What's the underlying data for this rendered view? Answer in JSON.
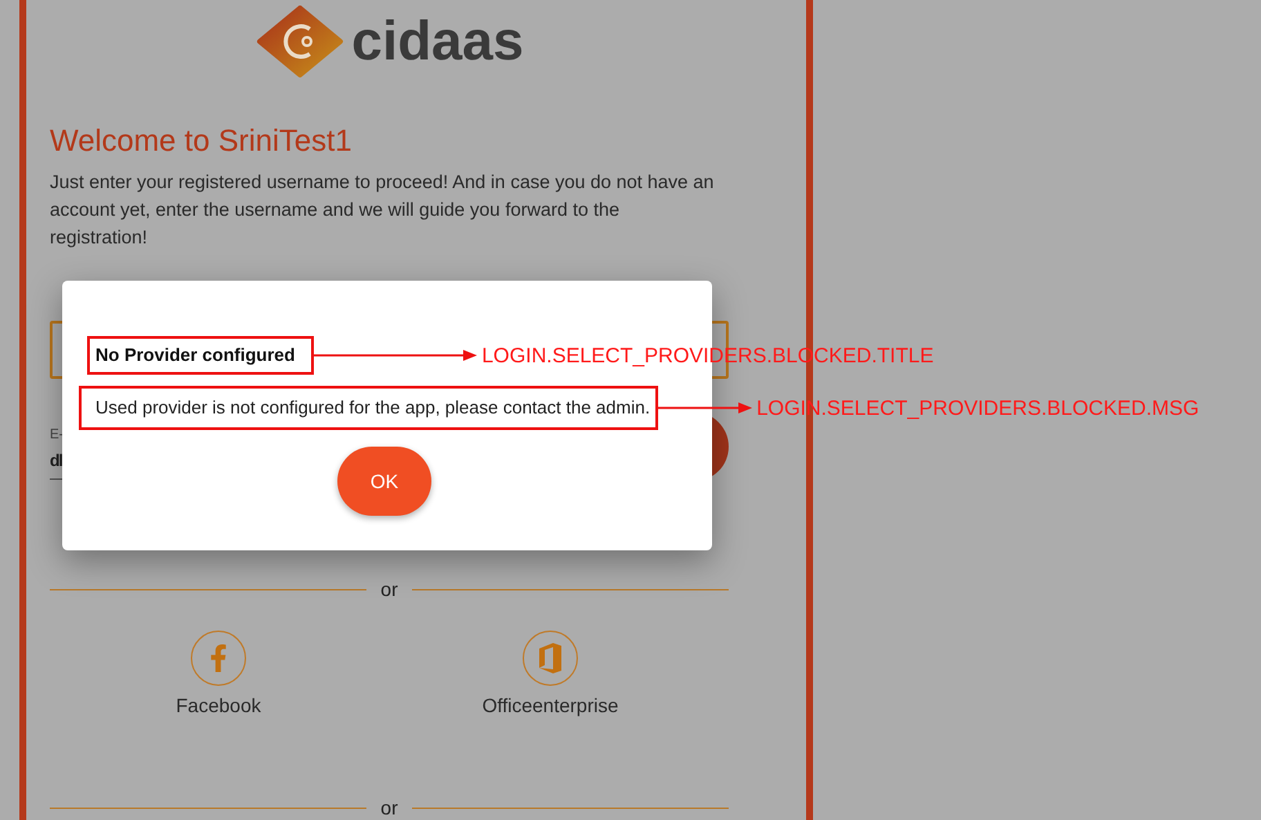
{
  "logo": {
    "wordmark": "cidaas"
  },
  "welcome": {
    "title": "Welcome to SriniTest1",
    "text": "Just enter your registered username to proceed! And in case you do not have an account yet, enter the username and we will guide you forward to the registration!"
  },
  "login_form": {
    "email_label": "E-",
    "email_value": "dl"
  },
  "dividers": [
    "or",
    "or"
  ],
  "providers": [
    {
      "kind": "facebook",
      "label": "Facebook"
    },
    {
      "kind": "office",
      "label": "Officeenterprise"
    }
  ],
  "dialog": {
    "title": "No Provider configured",
    "message": "Used provider is not configured for the app, please contact the admin.",
    "button": "OK"
  },
  "annotations": [
    {
      "kind": "title",
      "label": "LOGIN.SELECT_PROVIDERS.BLOCKED.TITLE"
    },
    {
      "kind": "message",
      "label": "LOGIN.SELECT_PROVIDERS.BLOCKED.MSG"
    }
  ]
}
